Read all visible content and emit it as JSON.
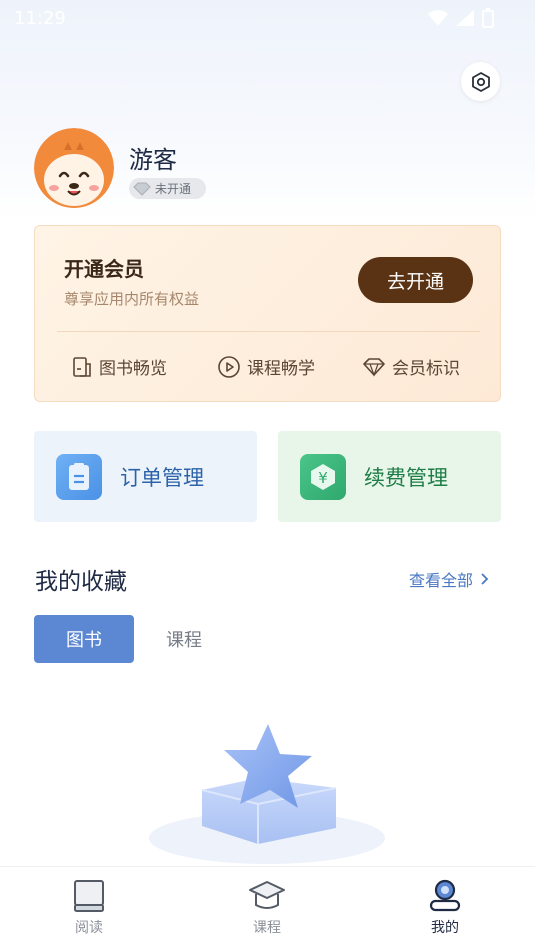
{
  "status_bar": {
    "time": "11:29"
  },
  "profile": {
    "name": "游客",
    "membership_badge": "未开通"
  },
  "vip_card": {
    "title": "开通会员",
    "subtitle": "尊享应用内所有权益",
    "button_label": "去开通",
    "features": [
      "图书畅览",
      "课程畅学",
      "会员标识"
    ]
  },
  "tiles": {
    "orders": "订单管理",
    "renewal": "续费管理"
  },
  "favorites": {
    "title": "我的收藏",
    "view_all": "查看全部",
    "tabs": [
      "图书",
      "课程"
    ]
  },
  "bottom_nav": {
    "items": [
      {
        "label": "阅读"
      },
      {
        "label": "课程"
      },
      {
        "label": "我的"
      }
    ]
  },
  "colors": {
    "vip_button": "#5a3314",
    "active_tab": "#5b87d3",
    "link": "#4a78c4"
  }
}
